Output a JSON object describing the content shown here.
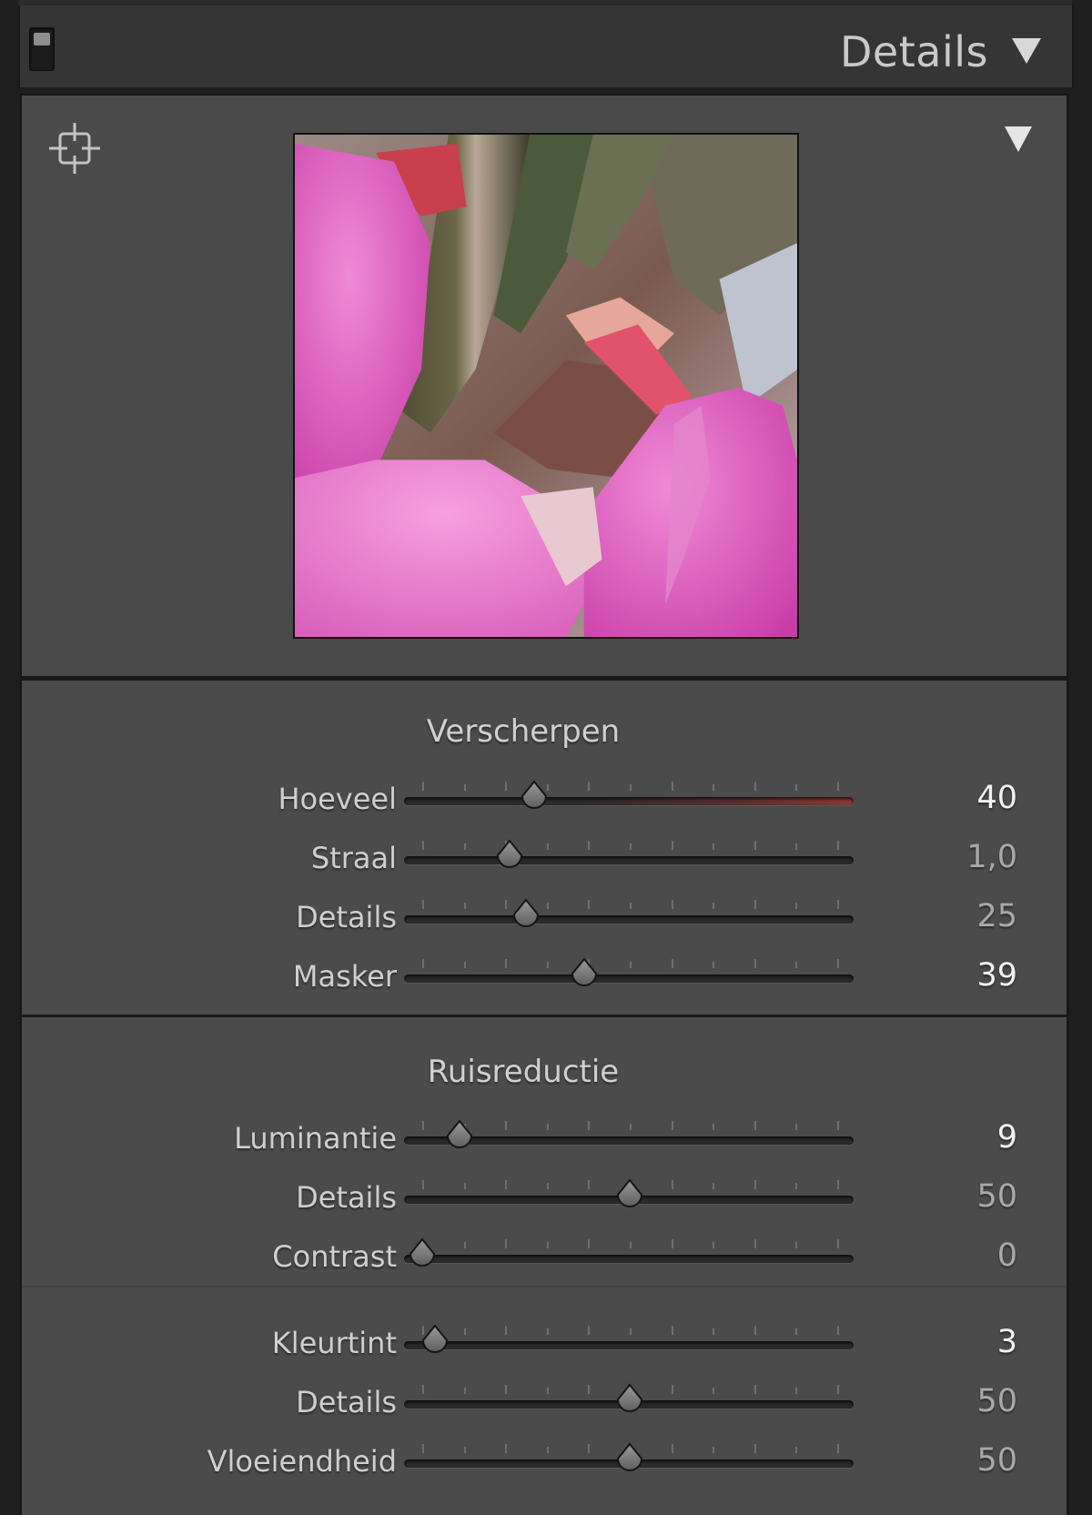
{
  "panel": {
    "title": "Details",
    "icons": {
      "collapse": "triangle-down-icon",
      "target": "target-adjust-icon",
      "switch": "panel-switch-icon"
    }
  },
  "preview": {
    "alt": "Detail preview of pink flower with green stem"
  },
  "sharpening": {
    "title": "Verscherpen",
    "sliders": [
      {
        "label": "Hoeveel",
        "value": "40",
        "level": 0.27,
        "active": true
      },
      {
        "label": "Straal",
        "value": "1,0",
        "level": 0.21,
        "active": false
      },
      {
        "label": "Details",
        "value": "25",
        "level": 0.25,
        "active": false
      },
      {
        "label": "Masker",
        "value": "39",
        "level": 0.39,
        "active": true
      }
    ]
  },
  "noise_reduction": {
    "title": "Ruisreductie",
    "luminance_sliders": [
      {
        "label": "Luminantie",
        "value": "9",
        "level": 0.09,
        "active": true
      },
      {
        "label": "Details",
        "value": "50",
        "level": 0.5,
        "active": false
      },
      {
        "label": "Contrast",
        "value": "0",
        "level": 0.0,
        "active": false
      }
    ],
    "color_sliders": [
      {
        "label": "Kleurtint",
        "value": "3",
        "level": 0.03,
        "active": true
      },
      {
        "label": "Details",
        "value": "50",
        "level": 0.5,
        "active": false
      },
      {
        "label": "Vloeiendheid",
        "value": "50",
        "level": 0.5,
        "active": false
      }
    ]
  }
}
